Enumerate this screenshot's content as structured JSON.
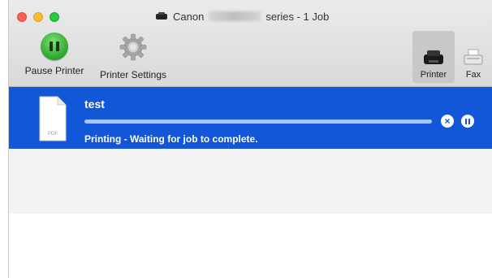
{
  "window": {
    "title_prefix": "Canon",
    "title_suffix": "series - 1 Job"
  },
  "toolbar": {
    "pause_printer_label": "Pause Printer",
    "printer_settings_label": "Printer Settings",
    "segments": [
      {
        "label": "Printer",
        "icon": "printer-icon",
        "selected": true
      },
      {
        "label": "Fax",
        "icon": "fax-icon",
        "selected": false
      }
    ]
  },
  "jobs": [
    {
      "name": "test",
      "file_type": "PDF",
      "status": "Printing - Waiting for job to complete.",
      "progress_fraction": 1.0
    }
  ],
  "colors": {
    "selection": "#1257d8",
    "pause_green": "#2aa52a"
  }
}
